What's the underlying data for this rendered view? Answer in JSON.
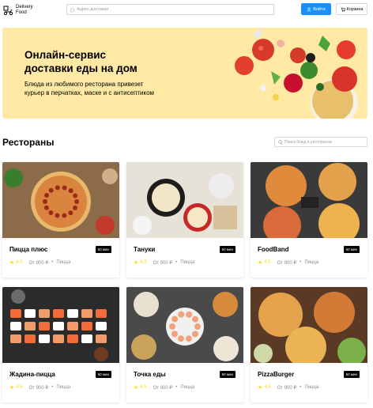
{
  "header": {
    "logo_text_line1": "Delivery",
    "logo_text_line2": "Food",
    "address_placeholder": "Адрес доставки",
    "login_label": "Войти",
    "cart_label": "Корзина"
  },
  "promo": {
    "title_line1": "Онлайн-сервис",
    "title_line2": "доставки еды на дом",
    "text_line1": "Блюда из любимого ресторана привезет",
    "text_line2": "курьер в перчатках, маске и с антисептиком"
  },
  "restaurants": {
    "title": "Рестораны",
    "search_placeholder": "Поиск блюд и ресторанов",
    "items": [
      {
        "name": "Пицца плюс",
        "time": "50 мин",
        "rating": "4.5",
        "price": "От 900 ₽",
        "category": "Пицца",
        "img": "pizza1"
      },
      {
        "name": "Тануки",
        "time": "50 мин",
        "rating": "4.5",
        "price": "От 900 ₽",
        "category": "Пицца",
        "img": "asian"
      },
      {
        "name": "FoodBand",
        "time": "50 мин",
        "rating": "4.5",
        "price": "От 900 ₽",
        "category": "Пицца",
        "img": "pizza2"
      },
      {
        "name": "Жадина-пицца",
        "time": "50 мин",
        "rating": "4.5",
        "price": "От 900 ₽",
        "category": "Пицца",
        "img": "sushi"
      },
      {
        "name": "Точка еды",
        "time": "50 мин",
        "rating": "4.5",
        "price": "От 900 ₽",
        "category": "Пицца",
        "img": "mix"
      },
      {
        "name": "PizzaBurger",
        "time": "50 мин",
        "rating": "4.5",
        "price": "От 900 ₽",
        "category": "Пицца",
        "img": "pizza3"
      }
    ]
  },
  "colors": {
    "accent": "#1890ff",
    "promo_bg": "#ffe9a5",
    "rating": "#fadb14",
    "muted": "#8c8c8c"
  }
}
